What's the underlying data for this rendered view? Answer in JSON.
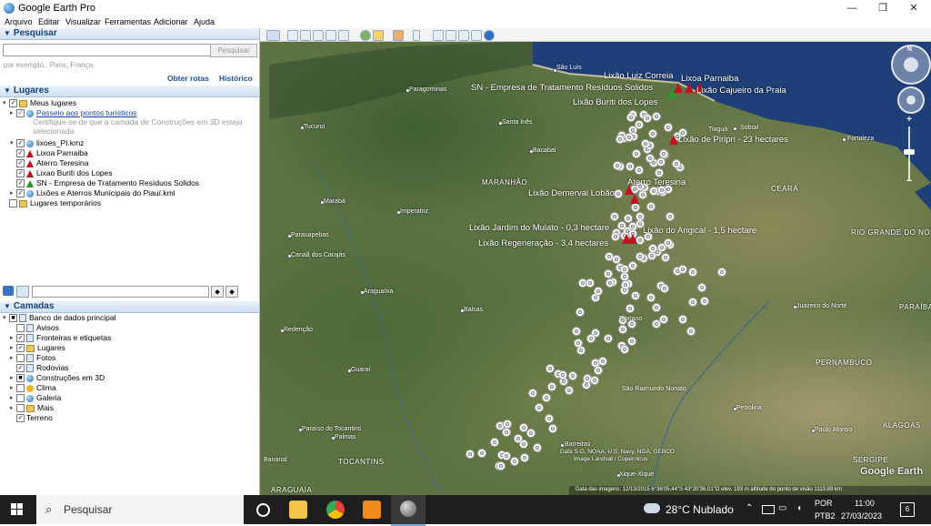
{
  "window": {
    "title": "Google Earth Pro",
    "minimize": "—",
    "maximize": "❐",
    "close": "✕"
  },
  "menu": [
    "Arquivo",
    "Editar",
    "Visualizar",
    "Ferramentas",
    "Adicionar",
    "Ajuda"
  ],
  "search": {
    "header": "Pesquisar",
    "placeholder": "",
    "button": "Pesquisar",
    "hint": "por exemplo,: Paris, França",
    "get_routes": "Obter rotas",
    "history": "Histórico"
  },
  "places": {
    "header": "Lugares",
    "items": [
      {
        "label": "Meus lugares",
        "icon": "folder-icon"
      },
      {
        "label": "Passeio aos pontos turísticos",
        "icon": "globe-icon"
      },
      {
        "label": "Certifique-se de que a camada de Construções em 3D esteja",
        "icon": ""
      },
      {
        "label": "selecionada",
        "icon": ""
      },
      {
        "label": "lixoes_PI.kmz",
        "icon": "globe-icon"
      },
      {
        "label": "Lixoa Parnaiba",
        "icon": "red-pin-icon"
      },
      {
        "label": "Aterro Teresina",
        "icon": "red-pin-icon"
      },
      {
        "label": "Lixao Buriti dos Lopes",
        "icon": "red-pin-icon"
      },
      {
        "label": "SN - Empresa de Tratamento Resíduos Solidos",
        "icon": "green-pin-icon"
      },
      {
        "label": "Lixões e Aterros Municipais do Piauí.kml",
        "icon": "globe-icon"
      },
      {
        "label": "Lugares temporários",
        "icon": "folder-icon"
      }
    ]
  },
  "layers": {
    "header": "Camadas",
    "items": [
      {
        "label": "Banco de dados principal"
      },
      {
        "label": "Avisos"
      },
      {
        "label": "Fronteiras e etiquetas"
      },
      {
        "label": "Lugares"
      },
      {
        "label": "Fotos"
      },
      {
        "label": "Rodovias"
      },
      {
        "label": "Construções em 3D"
      },
      {
        "label": "Clima"
      },
      {
        "label": "Galeria"
      },
      {
        "label": "Mais"
      },
      {
        "label": "Terreno"
      }
    ]
  },
  "map": {
    "cities": [
      "São Luís",
      "Paragominas",
      "Tucuruí",
      "Santa Inês",
      "Bacabal",
      "Marabá",
      "Imperatriz",
      "Parauapebas",
      "Canaã dos Carajás",
      "Araguaína",
      "Balsas",
      "Redenção",
      "Guaraí",
      "Paraíso do Tocantins",
      "Palmas",
      "Bananal",
      "Fortaleza",
      "Sobral",
      "Tiaguá",
      "Juazeiro do Norte",
      "Petrolina",
      "Barreiras",
      "Floriano",
      "Paulo Afonso",
      "São Raimundo Nonato",
      "Xique-Xique"
    ],
    "states": [
      "MARANHÃO",
      "CEARÁ",
      "RIO GRANDE DO NORTE",
      "PARAÍBA",
      "PERNAMBUCO",
      "ALAGOAS",
      "SERGIPE",
      "TOCANTINS",
      "ARAGUAIA"
    ],
    "labels": [
      "Lixão Luiz Correia",
      "Lixoa Parnaiba",
      "SN - Empresa de Tratamento Resíduos Solidos",
      "Lixão Cajueiro da Praia",
      "Lixão Buriti dos Lopes",
      "Lixão de Piripri - 23 hectares",
      "Aterro Teresina",
      "Lixão Demerval Lobão",
      "Lixão Jardim do Mulato - 0,3 hectare",
      "Lixão do Angical - 1,5 hectare",
      "Lixão Regeneração - 3,4 hectares"
    ],
    "attribution": "Data S.O. NOAA, U.S. Navy, NGA, GEBCO",
    "attribution2": "Image Landsat / Copernicus",
    "status": "Data das imagens: 12/13/2015     6°36'05.44\"S   43°20'36.01\"O   elev.  193 m      altitude do ponto de visão 1113.89 km",
    "logo": "Google Earth"
  },
  "taskbar": {
    "search": "Pesquisar",
    "weather": "28°C  Nublado",
    "lang1": "POR",
    "lang2": "PTB2",
    "time": "11:00",
    "date": "27/03/2023",
    "notif": "6"
  }
}
